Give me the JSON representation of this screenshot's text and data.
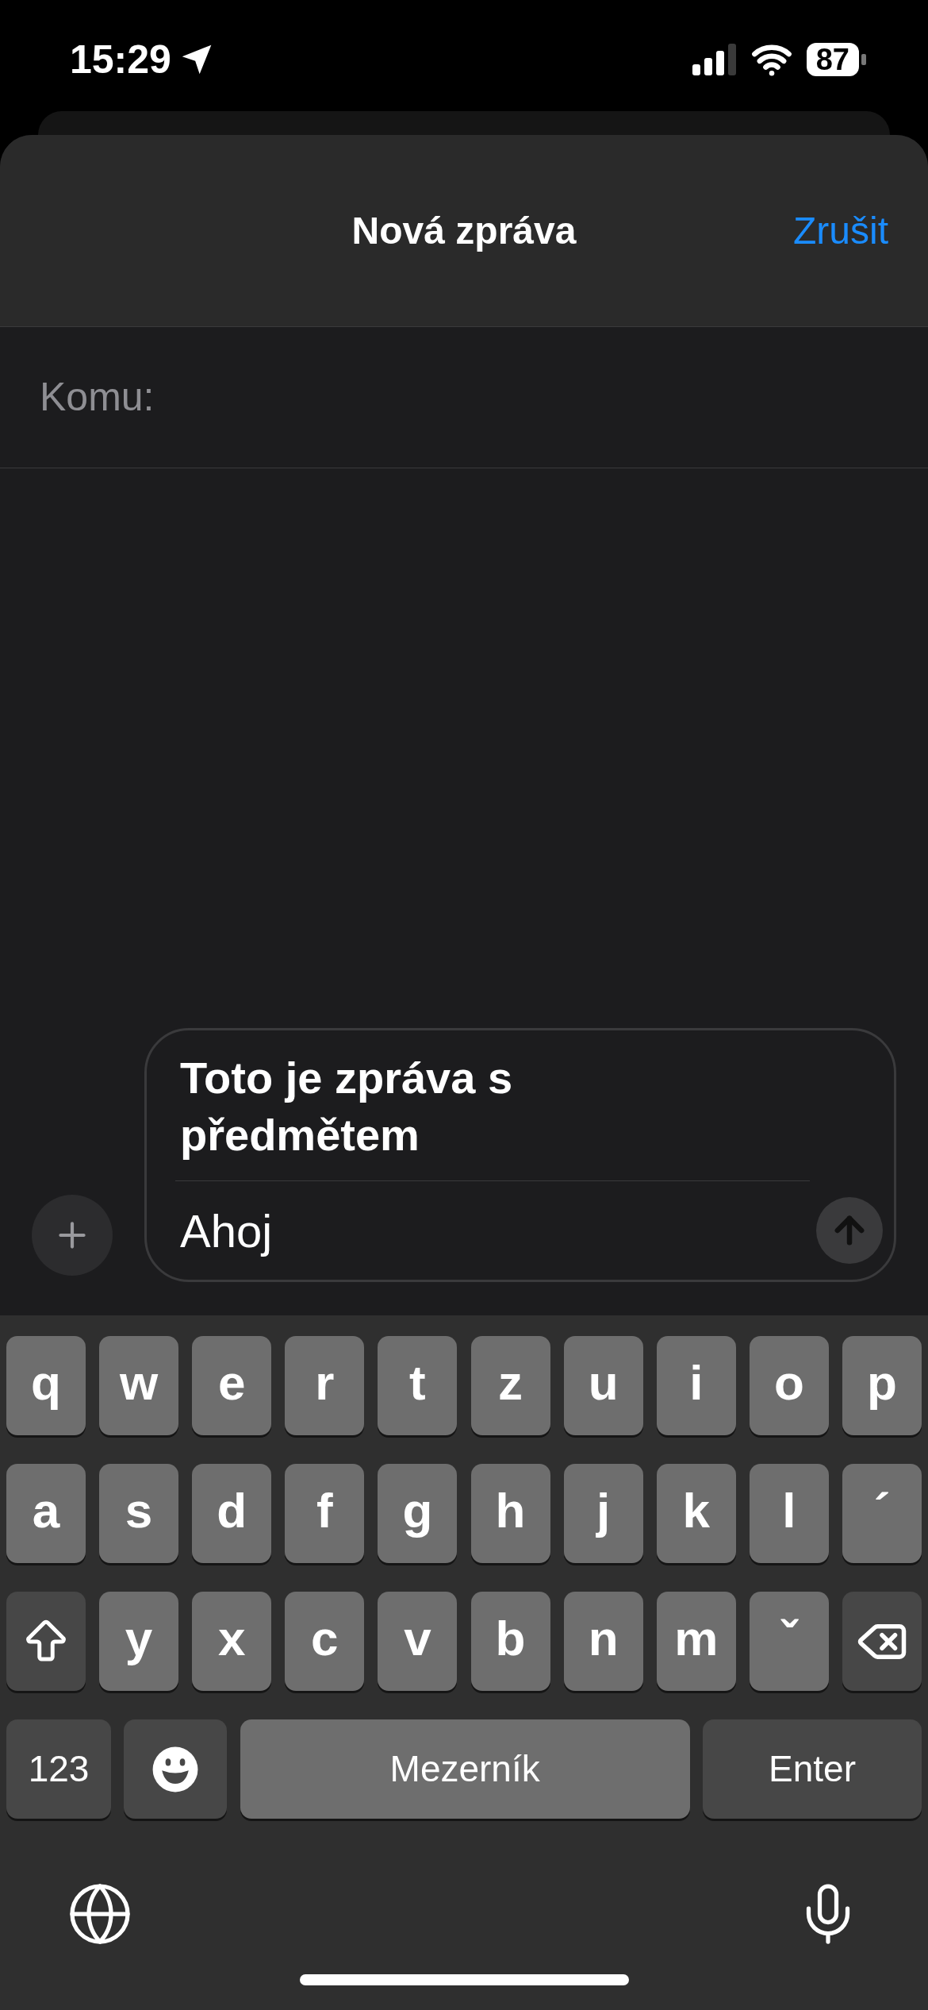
{
  "status_bar": {
    "time": "15:29",
    "battery": "87"
  },
  "header": {
    "title": "Nová zpráva",
    "cancel": "Zrušit"
  },
  "recipient": {
    "label": "Komu:"
  },
  "composer": {
    "subject": "Toto je zpráva s předmětem",
    "body": "Ahoj"
  },
  "keyboard": {
    "rows": [
      [
        {
          "kind": "letter",
          "label": "q"
        },
        {
          "kind": "letter",
          "label": "w"
        },
        {
          "kind": "letter",
          "label": "e"
        },
        {
          "kind": "letter",
          "label": "r"
        },
        {
          "kind": "letter",
          "label": "t"
        },
        {
          "kind": "letter",
          "label": "z"
        },
        {
          "kind": "letter",
          "label": "u"
        },
        {
          "kind": "letter",
          "label": "i"
        },
        {
          "kind": "letter",
          "label": "o"
        },
        {
          "kind": "letter",
          "label": "p"
        }
      ],
      [
        {
          "kind": "letter",
          "label": "a"
        },
        {
          "kind": "letter",
          "label": "s"
        },
        {
          "kind": "letter",
          "label": "d"
        },
        {
          "kind": "letter",
          "label": "f"
        },
        {
          "kind": "letter",
          "label": "g"
        },
        {
          "kind": "letter",
          "label": "h"
        },
        {
          "kind": "letter",
          "label": "j"
        },
        {
          "kind": "letter",
          "label": "k"
        },
        {
          "kind": "letter",
          "label": "l"
        },
        {
          "kind": "letter",
          "label": "´"
        }
      ],
      [
        {
          "kind": "shift"
        },
        {
          "kind": "letter",
          "label": "y"
        },
        {
          "kind": "letter",
          "label": "x"
        },
        {
          "kind": "letter",
          "label": "c"
        },
        {
          "kind": "letter",
          "label": "v"
        },
        {
          "kind": "letter",
          "label": "b"
        },
        {
          "kind": "letter",
          "label": "n"
        },
        {
          "kind": "letter",
          "label": "m"
        },
        {
          "kind": "letter",
          "label": "ˇ"
        },
        {
          "kind": "backspace"
        }
      ]
    ],
    "bottom_row": [
      {
        "kind": "numbers",
        "label": "123"
      },
      {
        "kind": "emoji"
      },
      {
        "kind": "space",
        "label": "Mezerník"
      },
      {
        "kind": "return",
        "label": "Enter"
      }
    ]
  }
}
